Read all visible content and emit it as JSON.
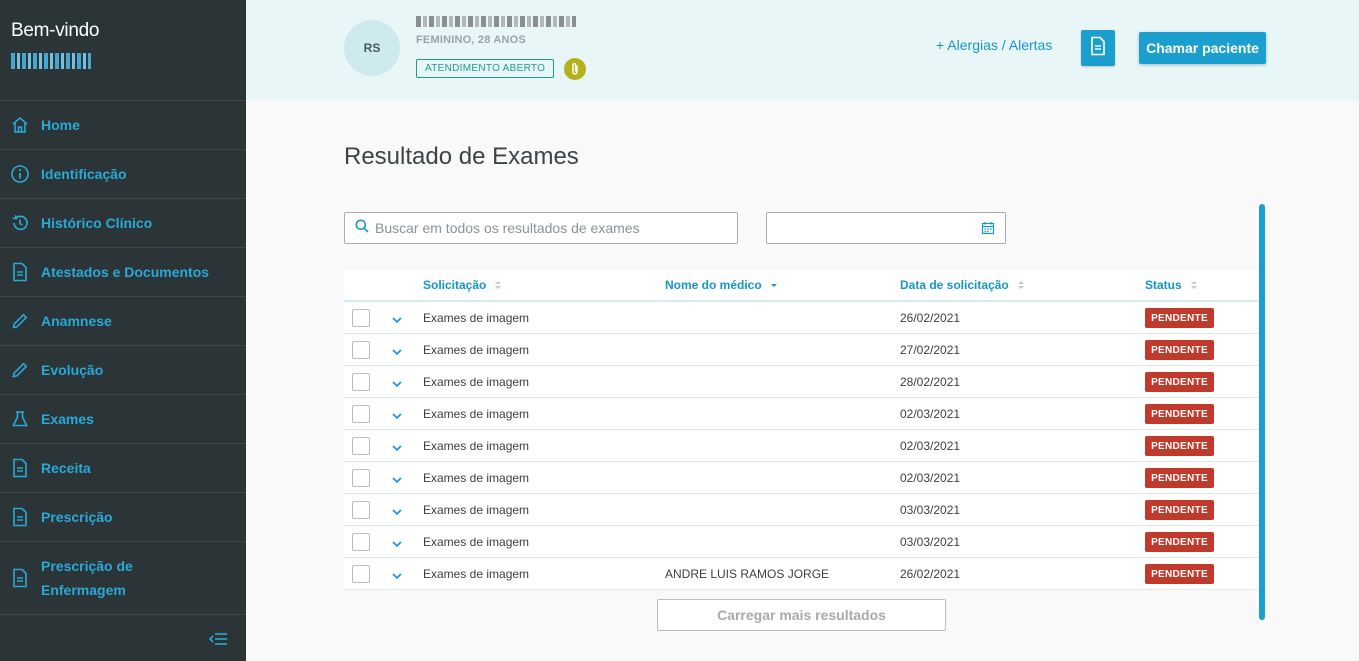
{
  "sidebar": {
    "welcome": "Bem-vindo",
    "items": [
      {
        "label": "Home",
        "icon": "home-icon"
      },
      {
        "label": "Identificação",
        "icon": "info-icon"
      },
      {
        "label": "Histórico Clínico",
        "icon": "history-icon"
      },
      {
        "label": "Atestados e Documentos",
        "icon": "document-icon"
      },
      {
        "label": "Anamnese",
        "icon": "pencil-icon"
      },
      {
        "label": "Evolução",
        "icon": "pencil-icon"
      },
      {
        "label": "Exames",
        "icon": "flask-icon"
      },
      {
        "label": "Receita",
        "icon": "document-icon"
      },
      {
        "label": "Prescrição",
        "icon": "document-icon"
      },
      {
        "label": "Prescrição de Enfermagem",
        "icon": "document-icon"
      }
    ],
    "collapse_icon": "collapse-menu-icon"
  },
  "header": {
    "avatar_initials": "RS",
    "patient_info": "FEMININO, 28 ANOS",
    "status_pill": "ATENDIMENTO ABERTO",
    "alerts_link": "+ Alergias / Alertas",
    "call_button": "Chamar paciente",
    "accent": "#1a9fcf"
  },
  "main": {
    "title": "Resultado de Exames",
    "search_placeholder": "Buscar em todos os resultados de exames",
    "date_value": "",
    "columns": [
      "Solicitação",
      "Nome do médico",
      "Data de solicitação",
      "Status"
    ],
    "rows": [
      {
        "solicitacao": "Exames de imagem",
        "medico": "",
        "data": "26/02/2021",
        "status": "PENDENTE"
      },
      {
        "solicitacao": "Exames de imagem",
        "medico": "",
        "data": "27/02/2021",
        "status": "PENDENTE"
      },
      {
        "solicitacao": "Exames de imagem",
        "medico": "",
        "data": "28/02/2021",
        "status": "PENDENTE"
      },
      {
        "solicitacao": "Exames de imagem",
        "medico": "",
        "data": "02/03/2021",
        "status": "PENDENTE"
      },
      {
        "solicitacao": "Exames de imagem",
        "medico": "",
        "data": "02/03/2021",
        "status": "PENDENTE"
      },
      {
        "solicitacao": "Exames de imagem",
        "medico": "",
        "data": "02/03/2021",
        "status": "PENDENTE"
      },
      {
        "solicitacao": "Exames de imagem",
        "medico": "",
        "data": "03/03/2021",
        "status": "PENDENTE"
      },
      {
        "solicitacao": "Exames de imagem",
        "medico": "",
        "data": "03/03/2021",
        "status": "PENDENTE"
      },
      {
        "solicitacao": "Exames de imagem",
        "medico": "ANDRE LUIS RAMOS JORGE",
        "data": "26/02/2021",
        "status": "PENDENTE"
      }
    ],
    "load_more": "Carregar mais resultados",
    "status_color": "#c0392b"
  }
}
